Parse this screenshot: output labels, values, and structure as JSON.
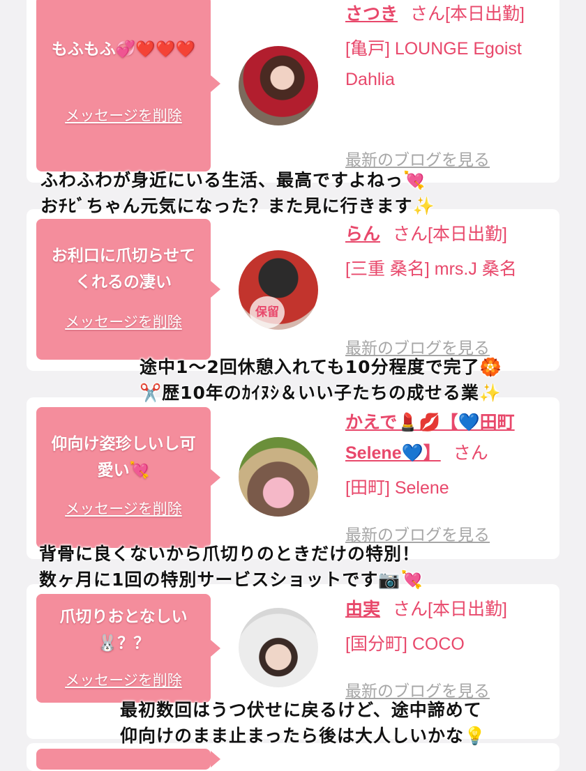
{
  "cards": [
    {
      "message": "もふもふ💞❤️❤️❤️",
      "delete_label": "メッセージを削除",
      "name": "さつき",
      "suffix": "さん[本日出勤]",
      "shop": "[亀戸] LOUNGE Egoist Dahlia",
      "blog_label": "最新のブログを見る"
    },
    {
      "message": "お利口に爪切らせてくれるの凄い",
      "delete_label": "メッセージを削除",
      "name": "らん",
      "suffix": "さん[本日出勤]",
      "shop": "[三重 桑名] mrs.J 桑名",
      "blog_label": "最新のブログを見る",
      "avatar_badge": "保留"
    },
    {
      "message": "仰向け姿珍しいし可愛い💘",
      "delete_label": "メッセージを削除",
      "name": "かえで💄💋【💙田町 Selene💙】",
      "suffix": "さん",
      "shop": "[田町] Selene",
      "blog_label": "最新のブログを見る"
    },
    {
      "message": "爪切りおとなしい🐰？？",
      "delete_label": "メッセージを削除",
      "name": "由実",
      "suffix": "さん[本日出勤]",
      "shop": "[国分町] COCO",
      "blog_label": "最新のブログを見る"
    }
  ],
  "captions": [
    {
      "line1": "ふわふわが身近にいる生活、最高ですよねっ💘",
      "line2": "おﾁﾋﾞちゃん元気になった？また見に行きます✨"
    },
    {
      "line1": "途中1〜2回休憩入れても10分程度で完了🏵️",
      "line2": "✂️歴10年のｶｲﾇｼ＆いい子たちの成せる業✨"
    },
    {
      "line1": "背骨に良くないから爪切りのときだけの特別！",
      "line2": "数ヶ月に1回の特別サービスショットです📷💘"
    },
    {
      "line1": "最初数回はうつ伏せに戻るけど、途中諦めて",
      "line2": "仰向けのまま止まったら後は大人しいかな💡"
    }
  ],
  "colors": {
    "accent": "#e8486b",
    "bubble": "#f48d9c",
    "background": "#f2f1f3",
    "muted": "#a6a6a6"
  }
}
